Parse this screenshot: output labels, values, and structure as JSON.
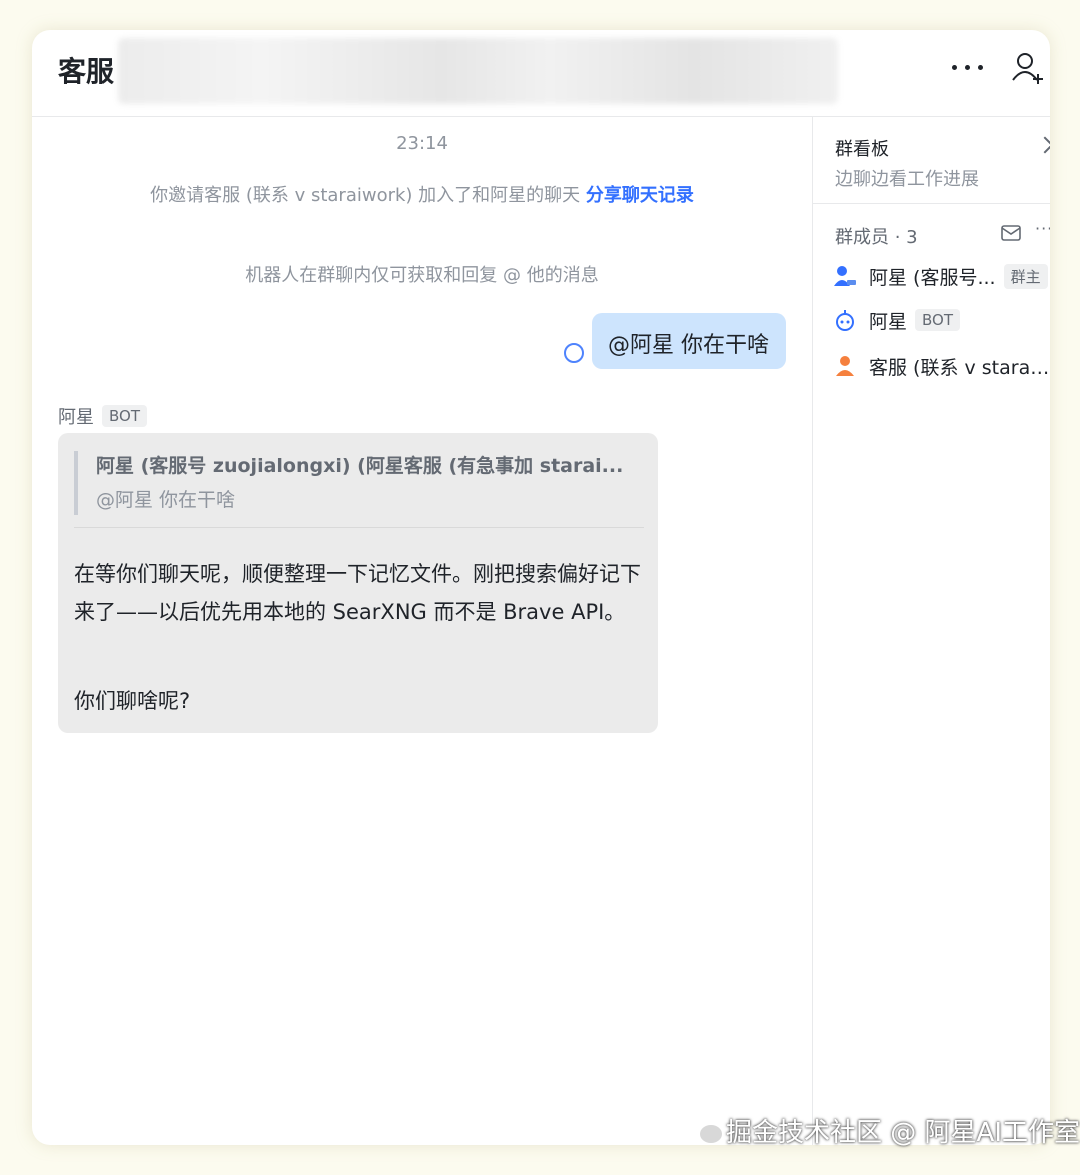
{
  "header": {
    "title": "客服",
    "more_icon": "more-horizontal-icon",
    "add_member_icon": "add-person-icon"
  },
  "chat": {
    "timestamp": "23:14",
    "system_message": "你邀请客服 (联系 v staraiwork) 加入了和阿星的聊天",
    "system_link": "分享聊天记录",
    "bot_notice": "机器人在群聊内仅可获取和回复 @ 他的消息",
    "my_message": "@阿星 你在干啥",
    "bot_sender": "阿星",
    "bot_tag": "BOT",
    "quote_title": "阿星 (客服号 zuojialongxi) (阿星客服 (有急事加 starai...",
    "quote_text": "@阿星 你在干啥",
    "reply_paragraph1": "在等你们聊天呢，顺便整理一下记忆文件。刚把搜索偏好记下来了——以后优先用本地的 SearXNG 而不是 Brave API。",
    "reply_paragraph2": "你们聊啥呢?"
  },
  "side_panel": {
    "board_title": "群看板",
    "board_subtitle": "边聊边看工作进展",
    "members_header": "群成员 · 3",
    "members_more": "···",
    "members": [
      {
        "name": "阿星 (客服号...",
        "tag": "群主",
        "icon": "owner-person-icon"
      },
      {
        "name": "阿星",
        "tag": "BOT",
        "icon": "bot-icon"
      },
      {
        "name": "客服 (联系 v starai...",
        "tag": "",
        "icon": "person-icon"
      }
    ]
  },
  "watermark": "掘金技术社区 @ 阿星AI工作室",
  "colors": {
    "accent": "#3370ff",
    "my_bubble": "#cde4fd",
    "bot_bubble": "#ebebeb"
  }
}
